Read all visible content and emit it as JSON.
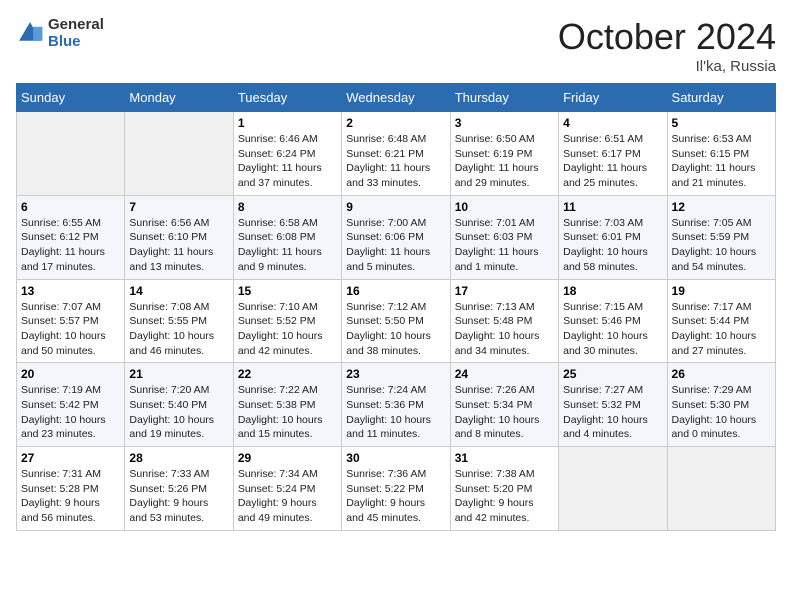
{
  "header": {
    "logo_general": "General",
    "logo_blue": "Blue",
    "month_title": "October 2024",
    "location": "Il'ka, Russia"
  },
  "weekdays": [
    "Sunday",
    "Monday",
    "Tuesday",
    "Wednesday",
    "Thursday",
    "Friday",
    "Saturday"
  ],
  "weeks": [
    [
      {
        "day": "",
        "info": ""
      },
      {
        "day": "",
        "info": ""
      },
      {
        "day": "1",
        "info": "Sunrise: 6:46 AM\nSunset: 6:24 PM\nDaylight: 11 hours\nand 37 minutes."
      },
      {
        "day": "2",
        "info": "Sunrise: 6:48 AM\nSunset: 6:21 PM\nDaylight: 11 hours\nand 33 minutes."
      },
      {
        "day": "3",
        "info": "Sunrise: 6:50 AM\nSunset: 6:19 PM\nDaylight: 11 hours\nand 29 minutes."
      },
      {
        "day": "4",
        "info": "Sunrise: 6:51 AM\nSunset: 6:17 PM\nDaylight: 11 hours\nand 25 minutes."
      },
      {
        "day": "5",
        "info": "Sunrise: 6:53 AM\nSunset: 6:15 PM\nDaylight: 11 hours\nand 21 minutes."
      }
    ],
    [
      {
        "day": "6",
        "info": "Sunrise: 6:55 AM\nSunset: 6:12 PM\nDaylight: 11 hours\nand 17 minutes."
      },
      {
        "day": "7",
        "info": "Sunrise: 6:56 AM\nSunset: 6:10 PM\nDaylight: 11 hours\nand 13 minutes."
      },
      {
        "day": "8",
        "info": "Sunrise: 6:58 AM\nSunset: 6:08 PM\nDaylight: 11 hours\nand 9 minutes."
      },
      {
        "day": "9",
        "info": "Sunrise: 7:00 AM\nSunset: 6:06 PM\nDaylight: 11 hours\nand 5 minutes."
      },
      {
        "day": "10",
        "info": "Sunrise: 7:01 AM\nSunset: 6:03 PM\nDaylight: 11 hours\nand 1 minute."
      },
      {
        "day": "11",
        "info": "Sunrise: 7:03 AM\nSunset: 6:01 PM\nDaylight: 10 hours\nand 58 minutes."
      },
      {
        "day": "12",
        "info": "Sunrise: 7:05 AM\nSunset: 5:59 PM\nDaylight: 10 hours\nand 54 minutes."
      }
    ],
    [
      {
        "day": "13",
        "info": "Sunrise: 7:07 AM\nSunset: 5:57 PM\nDaylight: 10 hours\nand 50 minutes."
      },
      {
        "day": "14",
        "info": "Sunrise: 7:08 AM\nSunset: 5:55 PM\nDaylight: 10 hours\nand 46 minutes."
      },
      {
        "day": "15",
        "info": "Sunrise: 7:10 AM\nSunset: 5:52 PM\nDaylight: 10 hours\nand 42 minutes."
      },
      {
        "day": "16",
        "info": "Sunrise: 7:12 AM\nSunset: 5:50 PM\nDaylight: 10 hours\nand 38 minutes."
      },
      {
        "day": "17",
        "info": "Sunrise: 7:13 AM\nSunset: 5:48 PM\nDaylight: 10 hours\nand 34 minutes."
      },
      {
        "day": "18",
        "info": "Sunrise: 7:15 AM\nSunset: 5:46 PM\nDaylight: 10 hours\nand 30 minutes."
      },
      {
        "day": "19",
        "info": "Sunrise: 7:17 AM\nSunset: 5:44 PM\nDaylight: 10 hours\nand 27 minutes."
      }
    ],
    [
      {
        "day": "20",
        "info": "Sunrise: 7:19 AM\nSunset: 5:42 PM\nDaylight: 10 hours\nand 23 minutes."
      },
      {
        "day": "21",
        "info": "Sunrise: 7:20 AM\nSunset: 5:40 PM\nDaylight: 10 hours\nand 19 minutes."
      },
      {
        "day": "22",
        "info": "Sunrise: 7:22 AM\nSunset: 5:38 PM\nDaylight: 10 hours\nand 15 minutes."
      },
      {
        "day": "23",
        "info": "Sunrise: 7:24 AM\nSunset: 5:36 PM\nDaylight: 10 hours\nand 11 minutes."
      },
      {
        "day": "24",
        "info": "Sunrise: 7:26 AM\nSunset: 5:34 PM\nDaylight: 10 hours\nand 8 minutes."
      },
      {
        "day": "25",
        "info": "Sunrise: 7:27 AM\nSunset: 5:32 PM\nDaylight: 10 hours\nand 4 minutes."
      },
      {
        "day": "26",
        "info": "Sunrise: 7:29 AM\nSunset: 5:30 PM\nDaylight: 10 hours\nand 0 minutes."
      }
    ],
    [
      {
        "day": "27",
        "info": "Sunrise: 7:31 AM\nSunset: 5:28 PM\nDaylight: 9 hours\nand 56 minutes."
      },
      {
        "day": "28",
        "info": "Sunrise: 7:33 AM\nSunset: 5:26 PM\nDaylight: 9 hours\nand 53 minutes."
      },
      {
        "day": "29",
        "info": "Sunrise: 7:34 AM\nSunset: 5:24 PM\nDaylight: 9 hours\nand 49 minutes."
      },
      {
        "day": "30",
        "info": "Sunrise: 7:36 AM\nSunset: 5:22 PM\nDaylight: 9 hours\nand 45 minutes."
      },
      {
        "day": "31",
        "info": "Sunrise: 7:38 AM\nSunset: 5:20 PM\nDaylight: 9 hours\nand 42 minutes."
      },
      {
        "day": "",
        "info": ""
      },
      {
        "day": "",
        "info": ""
      }
    ]
  ]
}
